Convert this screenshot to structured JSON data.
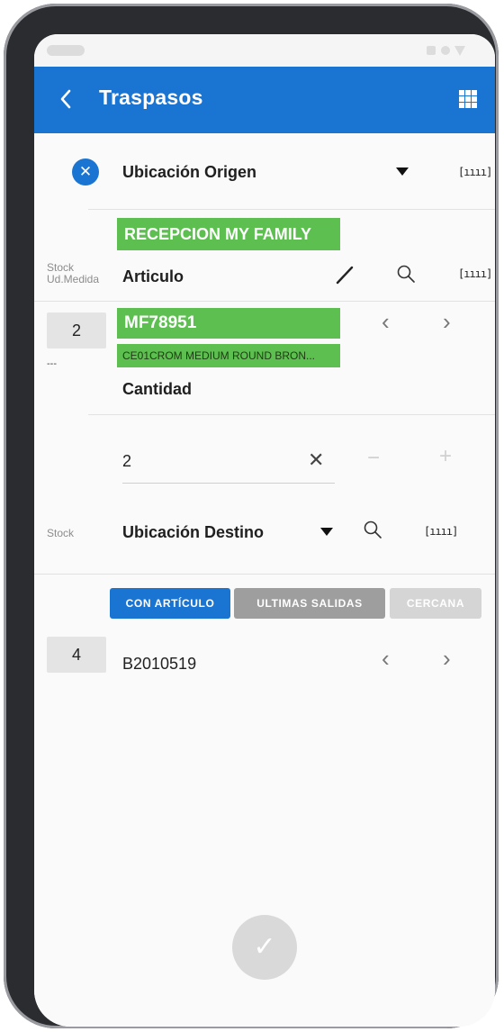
{
  "app_bar": {
    "back_icon": "chevron-left-icon",
    "title": "Traspasos",
    "menu_icon": "grid-menu-icon",
    "accent_color": "#1a75d2"
  },
  "origen": {
    "clear_icon": "close-circle-icon",
    "label": "Ubicación Origen",
    "selected_value": "RECEPCION MY FAMILY"
  },
  "articulo": {
    "side_label_1": "Stock",
    "side_label_2": "Ud.Medida",
    "label": "Articulo",
    "quantity_box": "2",
    "dash": "---",
    "code": "MF78951",
    "description": "CE01CROM MEDIUM ROUND BRON...",
    "highlight_color": "#5cbf4f"
  },
  "cantidad": {
    "label": "Cantidad",
    "value": "2",
    "clear_glyph": "✕",
    "minus_glyph": "−",
    "plus_glyph": "+"
  },
  "destino": {
    "side_label": "Stock",
    "label": "Ubicación Destino",
    "buttons": {
      "con_articulo": "CON ARTÍCULO",
      "ultimas_salidas": "ULTIMAS SALIDAS",
      "cercana": "CERCANA"
    },
    "quantity_box": "4",
    "value": "B2010519"
  },
  "nav_glyphs": {
    "prev": "‹",
    "next": "›"
  },
  "barcode_glyph": "[ıııı]",
  "search_glyph": "⌕",
  "confirm_icon": "check-icon",
  "confirm_glyph": "✓"
}
